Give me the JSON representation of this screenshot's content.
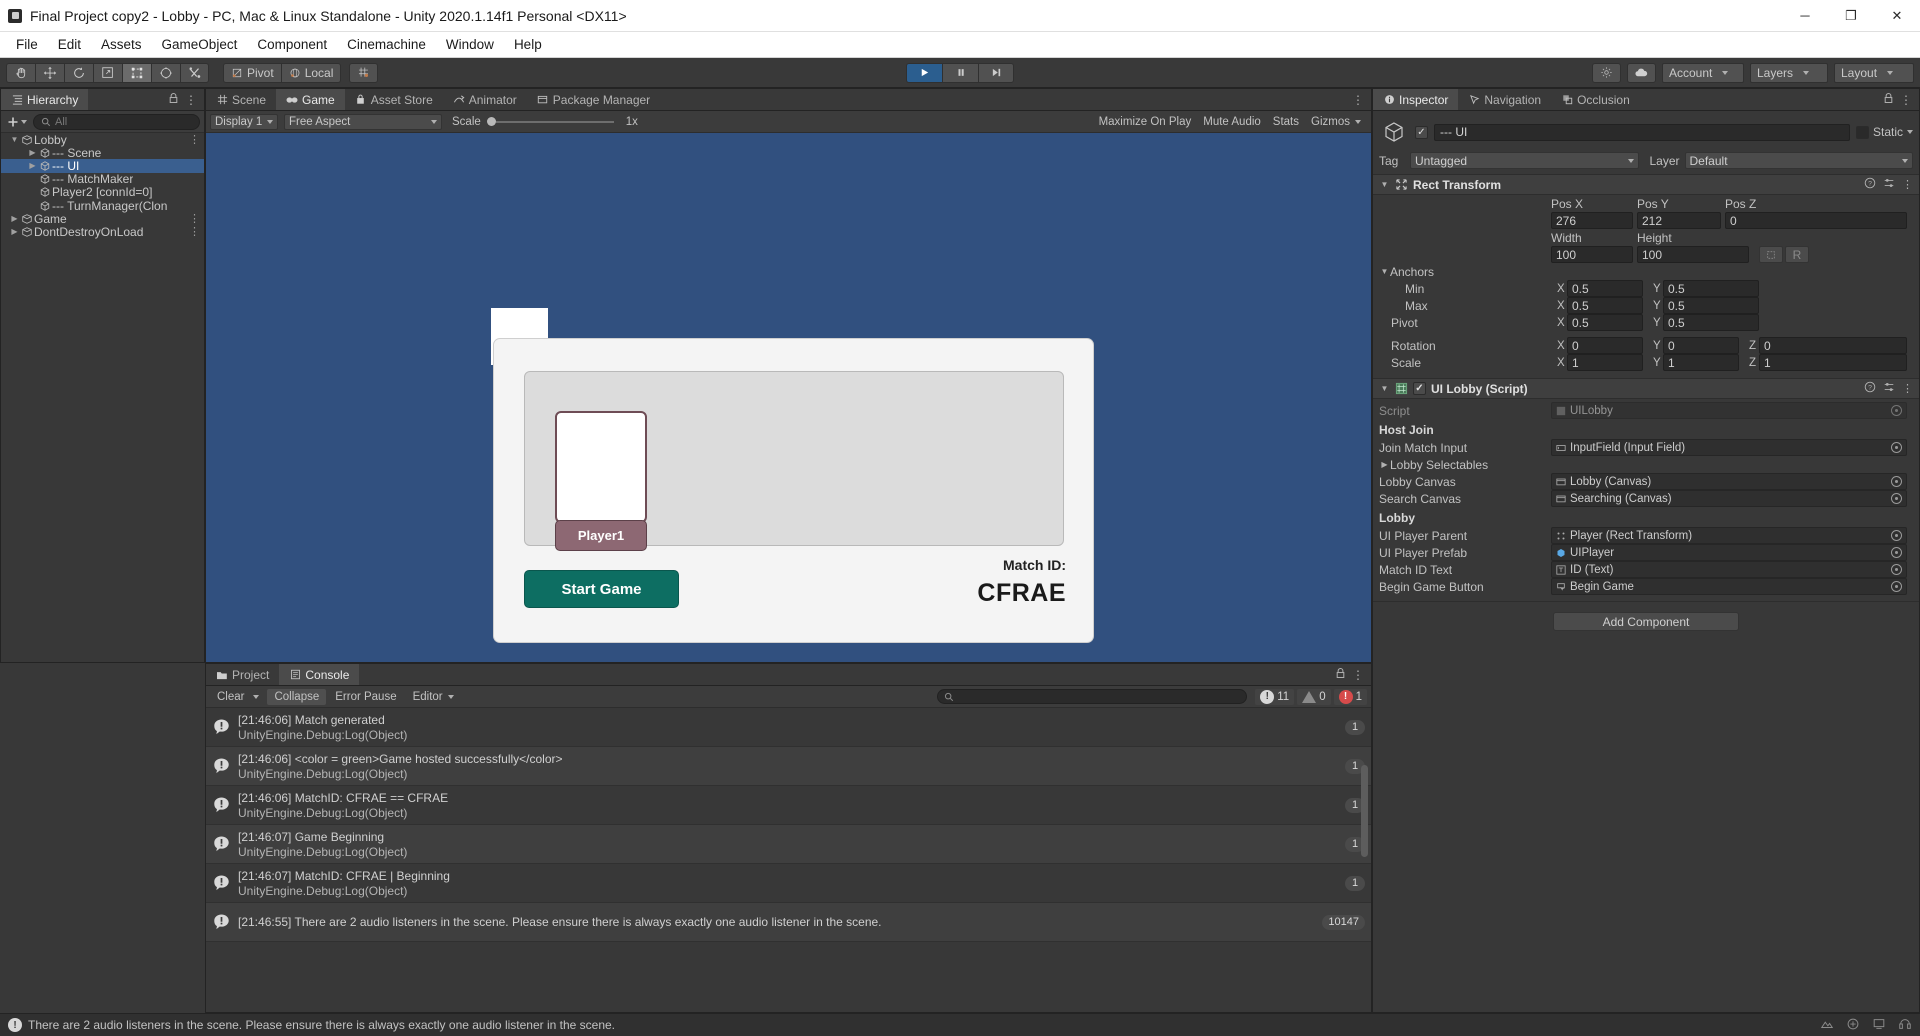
{
  "window": {
    "title": "Final Project copy2 - Lobby - PC, Mac & Linux Standalone - Unity 2020.1.14f1 Personal <DX11>",
    "minimize": "─",
    "maximize": "❐",
    "close": "✕"
  },
  "menu": [
    "File",
    "Edit",
    "Assets",
    "GameObject",
    "Component",
    "Cinemachine",
    "Window",
    "Help"
  ],
  "toolbar": {
    "tools": [
      "hand-tool",
      "move-tool",
      "rotate-tool",
      "scale-tool",
      "rect-tool",
      "transform-tool",
      "custom-tool"
    ],
    "pivot": "Pivot",
    "local": "Local",
    "play": "▶",
    "pause": "‖",
    "step": "▶|",
    "account": "Account",
    "layers": "Layers",
    "layout": "Layout"
  },
  "hierarchy": {
    "tab": "Hierarchy",
    "search_placeholder": "All",
    "rows": [
      {
        "label": "Lobby",
        "depth": 0,
        "type": "scene",
        "arrow": "▼",
        "menu": true,
        "selected": false
      },
      {
        "label": "--- Scene",
        "depth": 1,
        "type": "object",
        "arrow": "▶",
        "menu": false,
        "selected": false
      },
      {
        "label": "--- UI",
        "depth": 1,
        "type": "object",
        "arrow": "▶",
        "menu": false,
        "selected": true
      },
      {
        "label": "--- MatchMaker",
        "depth": 1,
        "type": "object",
        "arrow": "",
        "menu": false,
        "selected": false
      },
      {
        "label": "Player2 [connId=0]",
        "depth": 1,
        "type": "object",
        "arrow": "",
        "menu": false,
        "selected": false
      },
      {
        "label": "--- TurnManager(Clon",
        "depth": 1,
        "type": "object",
        "arrow": "",
        "menu": false,
        "selected": false
      },
      {
        "label": "Game",
        "depth": 0,
        "type": "scene",
        "arrow": "▶",
        "menu": true,
        "selected": false
      },
      {
        "label": "DontDestroyOnLoad",
        "depth": 0,
        "type": "scene",
        "arrow": "▶",
        "menu": true,
        "selected": false
      }
    ]
  },
  "center_tabs": [
    {
      "label": "Scene",
      "icon": "grid-icon",
      "active": false
    },
    {
      "label": "Game",
      "icon": "gamepad-icon",
      "active": true
    },
    {
      "label": "Asset Store",
      "icon": "store-icon",
      "active": false
    },
    {
      "label": "Animator",
      "icon": "animator-icon",
      "active": false
    },
    {
      "label": "Package Manager",
      "icon": "package-icon",
      "active": false
    }
  ],
  "game_toolbar": {
    "display": "Display 1",
    "aspect": "Free Aspect",
    "scale_label": "Scale",
    "scale_value": "1x",
    "maximize_on_play": "Maximize On Play",
    "mute_audio": "Mute Audio",
    "stats": "Stats",
    "gizmos": "Gizmos"
  },
  "game_view": {
    "background_color": "#31507f",
    "panel_bg": "#f4f4f4",
    "player_area_bg": "#dcdcdc",
    "player_name": "Player1",
    "player_name_bg": "#8d6873",
    "start_button": "Start Game",
    "start_button_bg": "#0d6e62",
    "match_id_label": "Match ID:",
    "match_id_value": "CFRAE"
  },
  "inspector": {
    "tabs": [
      {
        "label": "Inspector",
        "icon": "info-icon",
        "active": true
      },
      {
        "label": "Navigation",
        "icon": "navigation-icon",
        "active": false
      },
      {
        "label": "Occlusion",
        "icon": "occlusion-icon",
        "active": false
      }
    ],
    "object_name": "--- UI",
    "static_label": "Static",
    "tag_label": "Tag",
    "tag_value": "Untagged",
    "layer_label": "Layer",
    "layer_value": "Default",
    "rect_transform": {
      "title": "Rect Transform",
      "pos_x_label": "Pos X",
      "pos_y_label": "Pos Y",
      "pos_z_label": "Pos Z",
      "pos_x": "276",
      "pos_y": "212",
      "pos_z": "0",
      "width_label": "Width",
      "height_label": "Height",
      "width": "100",
      "height": "100",
      "anchors_label": "Anchors",
      "min_label": "Min",
      "min_x": "0.5",
      "min_y": "0.5",
      "max_label": "Max",
      "max_x": "0.5",
      "max_y": "0.5",
      "pivot_label": "Pivot",
      "pivot_x": "0.5",
      "pivot_y": "0.5",
      "rotation_label": "Rotation",
      "rot_x": "0",
      "rot_y": "0",
      "rot_z": "0",
      "scale_label": "Scale",
      "scale_x": "1",
      "scale_y": "1",
      "scale_z": "1"
    },
    "ui_lobby": {
      "title": "UI Lobby (Script)",
      "script_label": "Script",
      "script_value": "UILobby",
      "host_join_label": "Host Join",
      "join_match_input_label": "Join Match Input",
      "join_match_input_value": "InputField (Input Field)",
      "lobby_selectables_label": "Lobby Selectables",
      "lobby_canvas_label": "Lobby Canvas",
      "lobby_canvas_value": "Lobby (Canvas)",
      "search_canvas_label": "Search Canvas",
      "search_canvas_value": "Searching (Canvas)",
      "lobby_label": "Lobby",
      "ui_player_parent_label": "UI Player Parent",
      "ui_player_parent_value": "Player (Rect Transform)",
      "ui_player_prefab_label": "UI Player Prefab",
      "ui_player_prefab_value": "UIPlayer",
      "match_id_text_label": "Match ID Text",
      "match_id_text_value": "ID (Text)",
      "begin_game_button_label": "Begin Game Button",
      "begin_game_button_value": "Begin Game"
    },
    "add_component": "Add Component"
  },
  "console": {
    "tabs": [
      {
        "label": "Project",
        "icon": "folder-icon",
        "active": false
      },
      {
        "label": "Console",
        "icon": "console-icon",
        "active": true
      }
    ],
    "clear": "Clear",
    "collapse": "Collapse",
    "error_pause": "Error Pause",
    "editor": "Editor",
    "search_placeholder": "",
    "log_count": "11",
    "warning_count": "0",
    "error_count": "1",
    "rows": [
      {
        "message": "[21:46:06] Match generated",
        "stack": "UnityEngine.Debug:Log(Object)",
        "count": "1",
        "level": "log"
      },
      {
        "message": "[21:46:06] <color = green>Game hosted successfully</color>",
        "stack": "UnityEngine.Debug:Log(Object)",
        "count": "1",
        "level": "log"
      },
      {
        "message": "[21:46:06] MatchID: CFRAE == CFRAE",
        "stack": "UnityEngine.Debug:Log(Object)",
        "count": "1",
        "level": "log"
      },
      {
        "message": "[21:46:07] Game Beginning",
        "stack": "UnityEngine.Debug:Log(Object)",
        "count": "1",
        "level": "log"
      },
      {
        "message": "[21:46:07] MatchID: CFRAE | Beginning",
        "stack": "UnityEngine.Debug:Log(Object)",
        "count": "1",
        "level": "log"
      },
      {
        "message": "[21:46:55] There are 2 audio listeners in the scene. Please ensure there is always exactly one audio listener in the scene.",
        "stack": "",
        "count": "10147",
        "level": "log"
      }
    ]
  },
  "statusbar": {
    "message": "There are 2 audio listeners in the scene. Please ensure there is always exactly one audio listener in the scene."
  }
}
